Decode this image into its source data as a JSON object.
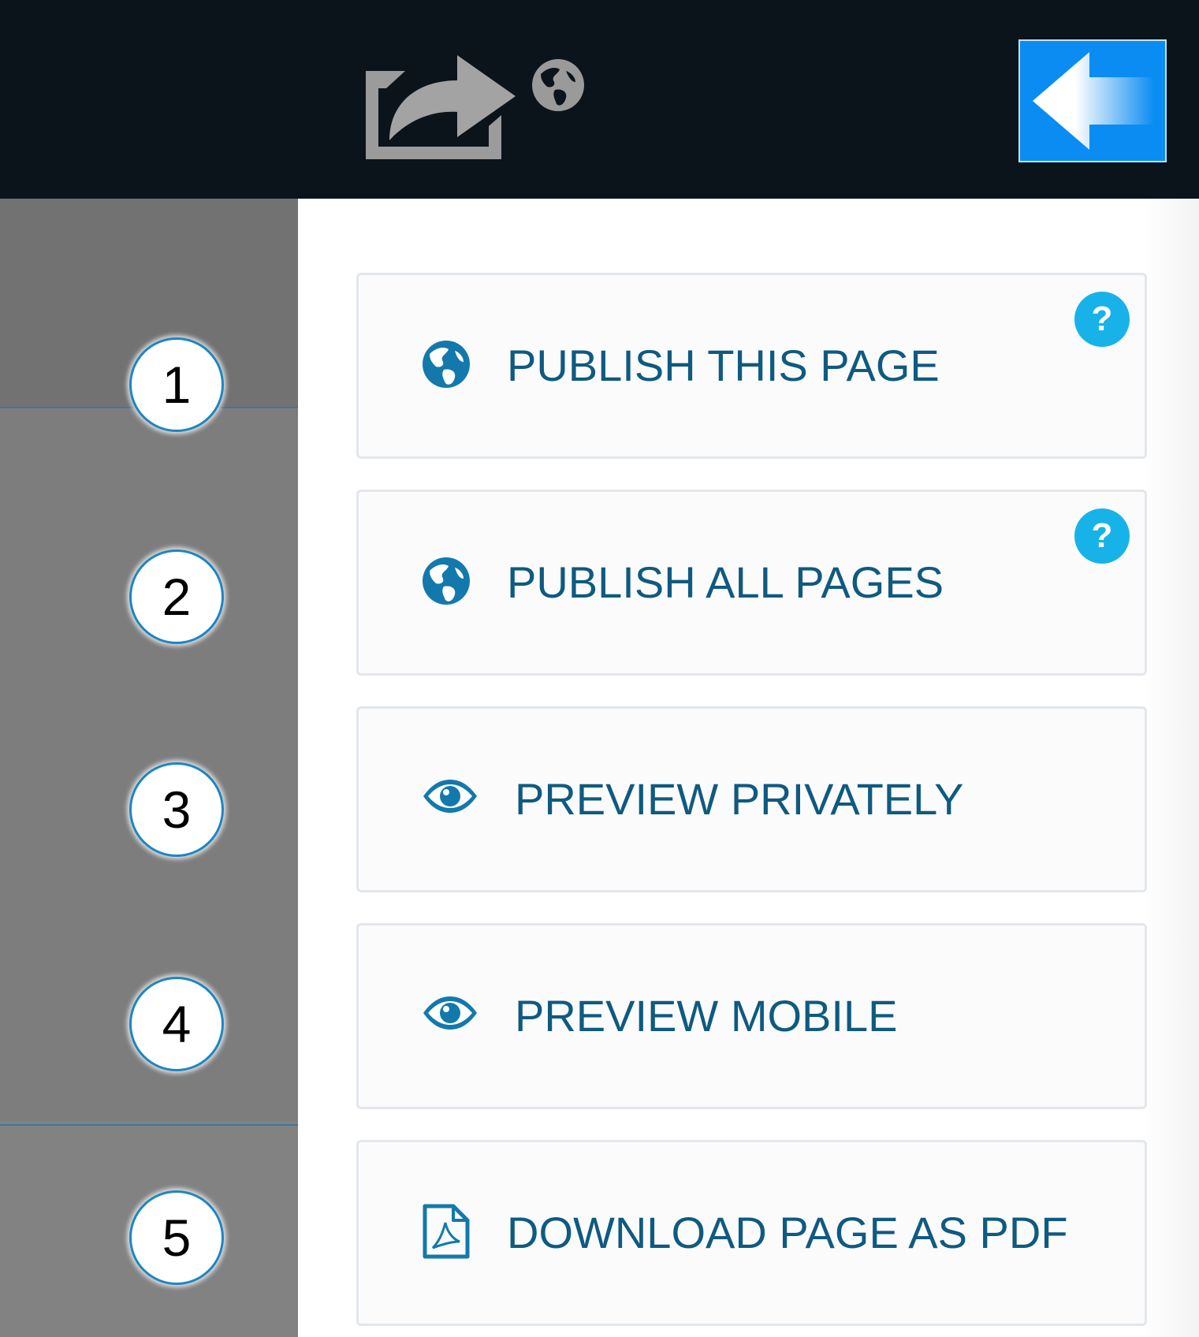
{
  "header": {
    "share_icon": "share-arrow-icon",
    "globe_icon": "globe-icon",
    "back_icon": "arrow-left-icon"
  },
  "sidebar": {
    "steps": [
      "1",
      "2",
      "3",
      "4",
      "5"
    ]
  },
  "menu": {
    "items": [
      {
        "label": "PUBLISH THIS PAGE",
        "icon": "globe-icon",
        "help": true
      },
      {
        "label": "PUBLISH ALL PAGES",
        "icon": "globe-icon",
        "help": true
      },
      {
        "label": "PREVIEW PRIVATELY",
        "icon": "eye-icon",
        "help": false
      },
      {
        "label": "PREVIEW MOBILE",
        "icon": "eye-icon",
        "help": false
      },
      {
        "label": "DOWNLOAD PAGE AS PDF",
        "icon": "pdf-file-icon",
        "help": false
      }
    ]
  },
  "colors": {
    "header_bg": "#0c141b",
    "accent_blue": "#0b8cf2",
    "label_blue": "#0f5a80",
    "help_cyan": "#17b3e8",
    "icon_blue": "#1379ad",
    "sidebar_gray": "#7d7d7d"
  }
}
